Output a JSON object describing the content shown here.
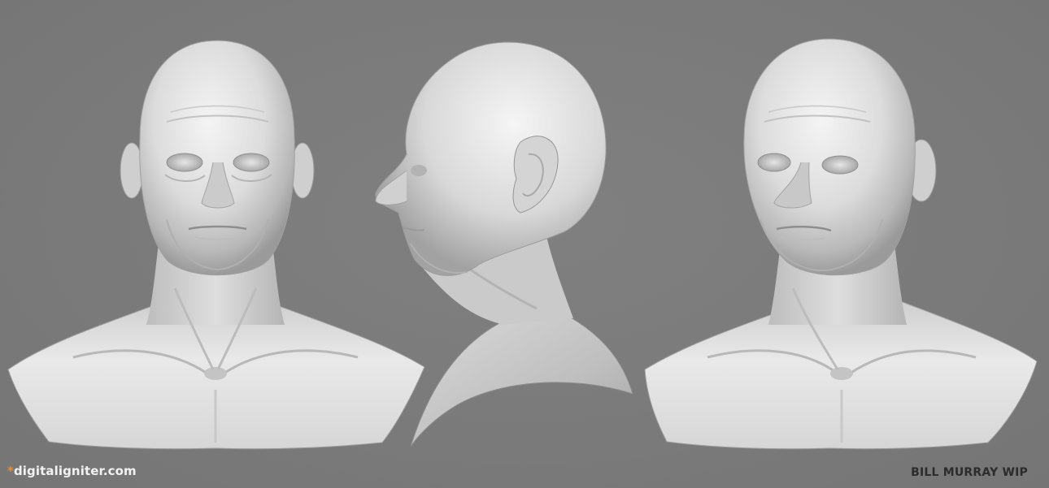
{
  "brand": {
    "asterisk": "*",
    "site": "digitaligniter.com",
    "asterisk_color": "#f08a2c"
  },
  "title": "BILL MURRAY WIP",
  "scene": {
    "background_color": "#7b7b7b",
    "views": [
      "front",
      "side-profile-left",
      "three-quarter"
    ]
  }
}
